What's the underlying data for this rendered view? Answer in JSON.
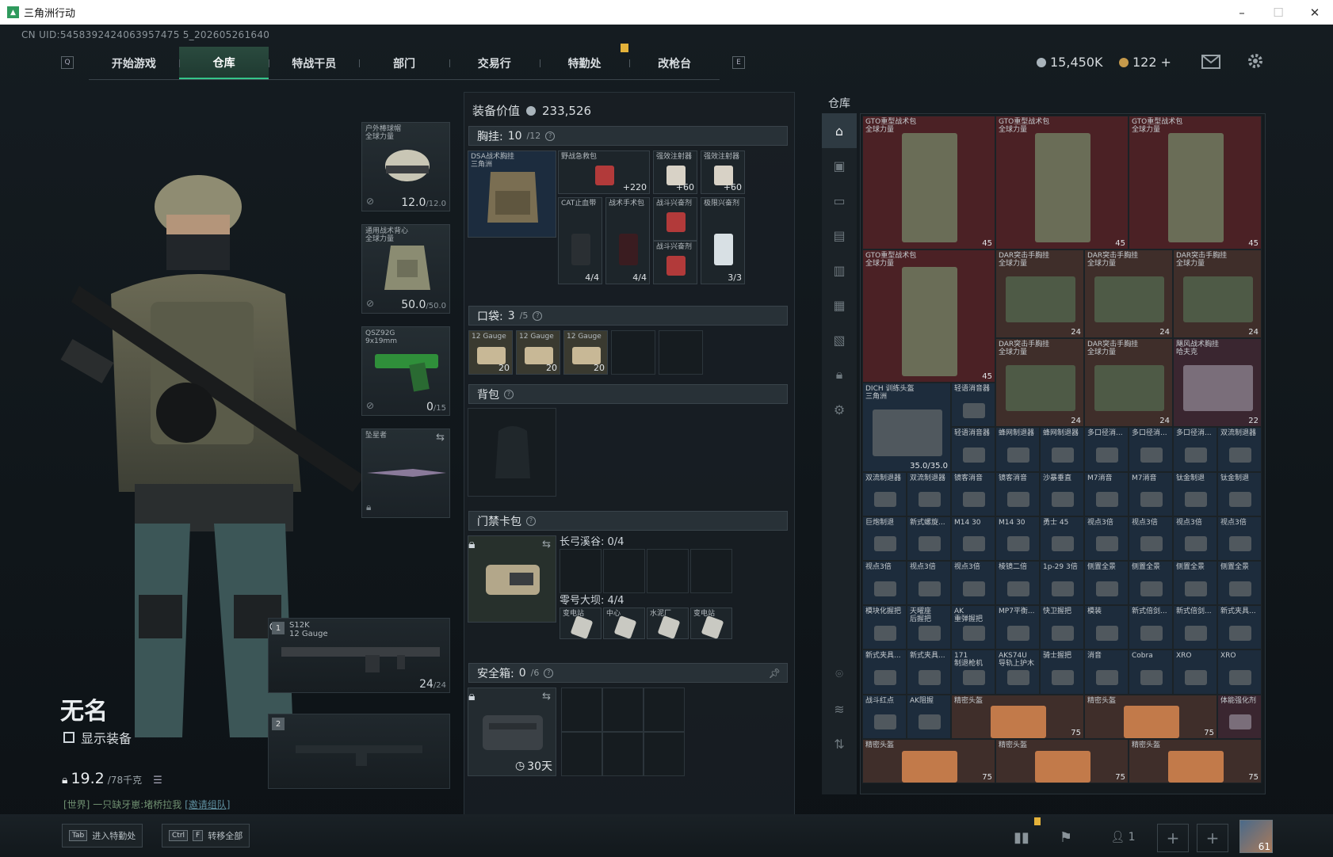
{
  "window": {
    "title": "三角洲行动",
    "min": "–",
    "max": "☐",
    "close": "✕"
  },
  "uid": "CN UID:5458392424063957475 5_202605261640",
  "nav": {
    "left_key": "Q",
    "right_key": "E",
    "tabs": [
      "开始游戏",
      "仓库",
      "特战干员",
      "部门",
      "交易行",
      "特勤处",
      "改枪台"
    ],
    "active": 1
  },
  "currency": {
    "silver": "15,450K",
    "gold": "122",
    "gold_plus": "+"
  },
  "character": {
    "name": "无名",
    "show_equipment": "显示装备",
    "weight": "19.2",
    "weight_max": "/78千克"
  },
  "chat": {
    "channel": "[世界]",
    "text": "一只缺牙崽:堵桥拉我",
    "link": "[邀请组队]"
  },
  "equip_slots": {
    "helmet": {
      "label1": "户外棒球帽",
      "label2": "全球力量",
      "value": "12.0",
      "max": "/12.0"
    },
    "armor": {
      "label1": "通用战术背心",
      "label2": "全球力量",
      "value": "50.0",
      "max": "/50.0"
    },
    "pistol": {
      "label1": "QSZ92G",
      "label2": "9x19mm",
      "value": "0",
      "max": "/15"
    },
    "melee": {
      "label1": "坠星者",
      "label2": ""
    },
    "primary": {
      "num": "1",
      "label1": "S12K",
      "label2": "12 Gauge",
      "value": "24",
      "max": "/24"
    },
    "secondary": {
      "num": "2"
    }
  },
  "loadout": {
    "value_label": "装备价值",
    "value": "233,526",
    "chest": {
      "title": "胸挂:",
      "cap": "10",
      "cap_max": "/12"
    },
    "chest_rig": {
      "label1": "DSA战术胸挂",
      "label2": "三角洲"
    },
    "chest_items": [
      {
        "label": "野战急救包",
        "count": "+220"
      },
      {
        "label": "强效注射器",
        "count": "+60"
      },
      {
        "label": "强效注射器",
        "count": "+60"
      },
      {
        "label": "CAT止血带",
        "count": "4/4"
      },
      {
        "label": "战术手术包",
        "count": "4/4"
      },
      {
        "label": "战斗兴奋剂",
        "count": ""
      },
      {
        "label": "战斗兴奋剂",
        "count": ""
      },
      {
        "label": "极限兴奋剂",
        "count": "3/3"
      }
    ],
    "pocket": {
      "title": "口袋:",
      "cap": "3",
      "cap_max": "/5"
    },
    "pocket_items": [
      {
        "label1": "12 Gauge",
        "count": "20"
      },
      {
        "label1": "12 Gauge",
        "count": "20"
      },
      {
        "label1": "12 Gauge",
        "count": "20"
      }
    ],
    "backpack": {
      "title": "背包"
    },
    "keycard": {
      "title": "门禁卡包"
    },
    "keycard_groups": [
      {
        "title": "长弓溪谷: 0/4",
        "items": [
          "",
          "",
          "",
          ""
        ]
      },
      {
        "title": "零号大坝: 4/4",
        "items": [
          "变电站",
          "中心",
          "水泥厂",
          "变电站"
        ]
      }
    ],
    "safe": {
      "title": "安全箱:",
      "cap": "0",
      "cap_max": "/6",
      "timer": "30天"
    }
  },
  "warehouse": {
    "title": "仓库",
    "items": [
      {
        "r": 0,
        "c": 0,
        "w": 3,
        "h": 3,
        "label1": "GTO重型战术包",
        "label2": "全球力量",
        "count": "45",
        "color": "red"
      },
      {
        "r": 0,
        "c": 3,
        "w": 3,
        "h": 3,
        "label1": "GTO重型战术包",
        "label2": "全球力量",
        "count": "45",
        "color": "red"
      },
      {
        "r": 0,
        "c": 6,
        "w": 3,
        "h": 3,
        "label1": "GTO重型战术包",
        "label2": "全球力量",
        "count": "45",
        "color": "red"
      },
      {
        "r": 3,
        "c": 0,
        "w": 3,
        "h": 3,
        "label1": "GTO重型战术包",
        "label2": "全球力量",
        "count": "45",
        "color": "red"
      },
      {
        "r": 3,
        "c": 3,
        "w": 2,
        "h": 2,
        "label1": "DAR突击手胸挂",
        "label2": "全球力量",
        "count": "24",
        "color": "brown"
      },
      {
        "r": 3,
        "c": 5,
        "w": 2,
        "h": 2,
        "label1": "DAR突击手胸挂",
        "label2": "全球力量",
        "count": "24",
        "color": "brown"
      },
      {
        "r": 3,
        "c": 7,
        "w": 2,
        "h": 2,
        "label1": "DAR突击手胸挂",
        "label2": "全球力量",
        "count": "24",
        "color": "brown"
      },
      {
        "r": 5,
        "c": 3,
        "w": 2,
        "h": 2,
        "label1": "DAR突击手胸挂",
        "label2": "全球力量",
        "count": "24",
        "color": "brown"
      },
      {
        "r": 5,
        "c": 5,
        "w": 2,
        "h": 2,
        "label1": "DAR突击手胸挂",
        "label2": "全球力量",
        "count": "24",
        "color": "brown"
      },
      {
        "r": 5,
        "c": 7,
        "w": 2,
        "h": 2,
        "label1": "飓风战术胸挂",
        "label2": "哈夫克",
        "count": "22",
        "color": "purple"
      },
      {
        "r": 6,
        "c": 0,
        "w": 2,
        "h": 2,
        "label1": "DICH 训练头盔",
        "label2": "三角洲",
        "count": "35.0/35.0",
        "color": "blue"
      },
      {
        "r": 6,
        "c": 2,
        "w": 1,
        "h": 1,
        "label1": "轻语消音器",
        "label2": "",
        "count": "",
        "color": "blue"
      },
      {
        "r": 7,
        "c": 2,
        "w": 1,
        "h": 1,
        "label1": "轻语消音器",
        "label2": "",
        "count": "",
        "color": "blue"
      },
      {
        "r": 7,
        "c": 3,
        "w": 1,
        "h": 1,
        "label1": "蜂网制退器",
        "label2": "",
        "count": "",
        "color": "blue"
      },
      {
        "r": 7,
        "c": 4,
        "w": 1,
        "h": 1,
        "label1": "蜂网制退器",
        "label2": "",
        "count": "",
        "color": "blue"
      },
      {
        "r": 7,
        "c": 5,
        "w": 1,
        "h": 1,
        "label1": "多口径消...",
        "label2": "",
        "count": "",
        "color": "blue"
      },
      {
        "r": 7,
        "c": 6,
        "w": 1,
        "h": 1,
        "label1": "多口径消...",
        "label2": "",
        "count": "",
        "color": "blue"
      },
      {
        "r": 7,
        "c": 7,
        "w": 1,
        "h": 1,
        "label1": "多口径消...",
        "label2": "",
        "count": "",
        "color": "blue"
      },
      {
        "r": 7,
        "c": 8,
        "w": 1,
        "h": 1,
        "label1": "双流制退器",
        "label2": "",
        "count": "",
        "color": "blue"
      },
      {
        "r": 8,
        "c": 0,
        "w": 1,
        "h": 1,
        "label1": "双流制退器",
        "label2": "",
        "count": "",
        "color": "blue"
      },
      {
        "r": 8,
        "c": 1,
        "w": 1,
        "h": 1,
        "label1": "双流制退器",
        "label2": "",
        "count": "",
        "color": "blue"
      },
      {
        "r": 8,
        "c": 2,
        "w": 1,
        "h": 1,
        "label1": "镜客消音",
        "label2": "",
        "count": "",
        "color": "blue"
      },
      {
        "r": 8,
        "c": 3,
        "w": 1,
        "h": 1,
        "label1": "镜客消音",
        "label2": "",
        "count": "",
        "color": "blue"
      },
      {
        "r": 8,
        "c": 4,
        "w": 1,
        "h": 1,
        "label1": "沙暴垂直",
        "label2": "",
        "count": "",
        "color": "blue"
      },
      {
        "r": 8,
        "c": 5,
        "w": 1,
        "h": 1,
        "label1": "M7消音",
        "label2": "",
        "count": "",
        "color": "blue"
      },
      {
        "r": 8,
        "c": 6,
        "w": 1,
        "h": 1,
        "label1": "M7消音",
        "label2": "",
        "count": "",
        "color": "blue"
      },
      {
        "r": 8,
        "c": 7,
        "w": 1,
        "h": 1,
        "label1": "钛金制退",
        "label2": "",
        "count": "",
        "color": "blue"
      },
      {
        "r": 8,
        "c": 8,
        "w": 1,
        "h": 1,
        "label1": "钛金制退",
        "label2": "",
        "count": "",
        "color": "blue"
      },
      {
        "r": 9,
        "c": 0,
        "w": 1,
        "h": 1,
        "label1": "巨炮制退",
        "label2": "",
        "count": "",
        "color": "blue"
      },
      {
        "r": 9,
        "c": 1,
        "w": 1,
        "h": 1,
        "label1": "新式螺旋...",
        "label2": "",
        "count": "",
        "color": "blue"
      },
      {
        "r": 9,
        "c": 2,
        "w": 1,
        "h": 1,
        "label1": "M14 30",
        "label2": "",
        "count": "",
        "color": "blue"
      },
      {
        "r": 9,
        "c": 3,
        "w": 1,
        "h": 1,
        "label1": "M14 30",
        "label2": "",
        "count": "",
        "color": "blue"
      },
      {
        "r": 9,
        "c": 4,
        "w": 1,
        "h": 1,
        "label1": "勇士 45",
        "label2": "",
        "count": "",
        "color": "blue"
      },
      {
        "r": 9,
        "c": 5,
        "w": 1,
        "h": 1,
        "label1": "视点3倍",
        "label2": "",
        "count": "",
        "color": "blue"
      },
      {
        "r": 9,
        "c": 6,
        "w": 1,
        "h": 1,
        "label1": "视点3倍",
        "label2": "",
        "count": "",
        "color": "blue"
      },
      {
        "r": 9,
        "c": 7,
        "w": 1,
        "h": 1,
        "label1": "视点3倍",
        "label2": "",
        "count": "",
        "color": "blue"
      },
      {
        "r": 9,
        "c": 8,
        "w": 1,
        "h": 1,
        "label1": "视点3倍",
        "label2": "",
        "count": "",
        "color": "blue"
      },
      {
        "r": 10,
        "c": 0,
        "w": 1,
        "h": 1,
        "label1": "视点3倍",
        "label2": "",
        "count": "",
        "color": "blue"
      },
      {
        "r": 10,
        "c": 1,
        "w": 1,
        "h": 1,
        "label1": "视点3倍",
        "label2": "",
        "count": "",
        "color": "blue"
      },
      {
        "r": 10,
        "c": 2,
        "w": 1,
        "h": 1,
        "label1": "视点3倍",
        "label2": "",
        "count": "",
        "color": "blue"
      },
      {
        "r": 10,
        "c": 3,
        "w": 1,
        "h": 1,
        "label1": "棱镜二倍",
        "label2": "",
        "count": "",
        "color": "blue"
      },
      {
        "r": 10,
        "c": 4,
        "w": 1,
        "h": 1,
        "label1": "1p-29 3倍",
        "label2": "",
        "count": "",
        "color": "blue"
      },
      {
        "r": 10,
        "c": 5,
        "w": 1,
        "h": 1,
        "label1": "侧置全景",
        "label2": "",
        "count": "",
        "color": "blue"
      },
      {
        "r": 10,
        "c": 6,
        "w": 1,
        "h": 1,
        "label1": "侧置全景",
        "label2": "",
        "count": "",
        "color": "blue"
      },
      {
        "r": 10,
        "c": 7,
        "w": 1,
        "h": 1,
        "label1": "侧置全景",
        "label2": "",
        "count": "",
        "color": "blue"
      },
      {
        "r": 10,
        "c": 8,
        "w": 1,
        "h": 1,
        "label1": "侧置全景",
        "label2": "",
        "count": "",
        "color": "blue"
      },
      {
        "r": 11,
        "c": 0,
        "w": 1,
        "h": 1,
        "label1": "模块化握把",
        "label2": "",
        "count": "",
        "color": "blue"
      },
      {
        "r": 11,
        "c": 1,
        "w": 1,
        "h": 1,
        "label1": "天曜座",
        "label2": "后握把",
        "count": "",
        "color": "blue"
      },
      {
        "r": 11,
        "c": 2,
        "w": 1,
        "h": 1,
        "label1": "AK",
        "label2": "重弹握把",
        "count": "",
        "color": "blue"
      },
      {
        "r": 11,
        "c": 3,
        "w": 1,
        "h": 1,
        "label1": "MP7平衡...",
        "label2": "",
        "count": "",
        "color": "blue"
      },
      {
        "r": 11,
        "c": 4,
        "w": 1,
        "h": 1,
        "label1": "快卫握把",
        "label2": "",
        "count": "",
        "color": "blue"
      },
      {
        "r": 11,
        "c": 5,
        "w": 1,
        "h": 1,
        "label1": "模装",
        "label2": "",
        "count": "",
        "color": "blue"
      },
      {
        "r": 11,
        "c": 6,
        "w": 1,
        "h": 1,
        "label1": "新式倍剑...",
        "label2": "",
        "count": "",
        "color": "blue"
      },
      {
        "r": 11,
        "c": 7,
        "w": 1,
        "h": 1,
        "label1": "新式倍剑...",
        "label2": "",
        "count": "",
        "color": "blue"
      },
      {
        "r": 11,
        "c": 8,
        "w": 1,
        "h": 1,
        "label1": "新式夹具...",
        "label2": "",
        "count": "",
        "color": "blue"
      },
      {
        "r": 12,
        "c": 0,
        "w": 1,
        "h": 1,
        "label1": "新式夹具...",
        "label2": "",
        "count": "",
        "color": "blue"
      },
      {
        "r": 12,
        "c": 1,
        "w": 1,
        "h": 1,
        "label1": "新式夹具...",
        "label2": "",
        "count": "",
        "color": "blue"
      },
      {
        "r": 12,
        "c": 2,
        "w": 1,
        "h": 1,
        "label1": "171",
        "label2": "制退枪机",
        "count": "",
        "color": "blue"
      },
      {
        "r": 12,
        "c": 3,
        "w": 1,
        "h": 1,
        "label1": "AKS74U",
        "label2": "导轨上护木",
        "count": "",
        "color": "blue"
      },
      {
        "r": 12,
        "c": 4,
        "w": 1,
        "h": 1,
        "label1": "骑士握把",
        "label2": "",
        "count": "",
        "color": "blue"
      },
      {
        "r": 12,
        "c": 5,
        "w": 1,
        "h": 1,
        "label1": "消音",
        "label2": "",
        "count": "",
        "color": "blue"
      },
      {
        "r": 12,
        "c": 6,
        "w": 1,
        "h": 1,
        "label1": "Cobra",
        "label2": "",
        "count": "",
        "color": "blue"
      },
      {
        "r": 12,
        "c": 7,
        "w": 1,
        "h": 1,
        "label1": "XRO",
        "label2": "",
        "count": "",
        "color": "blue"
      },
      {
        "r": 12,
        "c": 8,
        "w": 1,
        "h": 1,
        "label1": "XRO",
        "label2": "",
        "count": "",
        "color": "blue"
      },
      {
        "r": 13,
        "c": 0,
        "w": 1,
        "h": 1,
        "label1": "战斗红点",
        "label2": "",
        "count": "",
        "color": "blue"
      },
      {
        "r": 13,
        "c": 1,
        "w": 1,
        "h": 1,
        "label1": "AK阻握",
        "label2": "",
        "count": "",
        "color": "blue"
      },
      {
        "r": 13,
        "c": 2,
        "w": 3,
        "h": 1,
        "label1": "精密头盔",
        "label2": "",
        "count": "75",
        "color": "brown"
      },
      {
        "r": 13,
        "c": 5,
        "w": 3,
        "h": 1,
        "label1": "精密头盔",
        "label2": "",
        "count": "75",
        "color": "brown"
      },
      {
        "r": 13,
        "c": 8,
        "w": 1,
        "h": 1,
        "label1": "体能强化剂",
        "label2": "",
        "count": "",
        "color": "purple"
      },
      {
        "r": 14,
        "c": 0,
        "w": 3,
        "h": 1,
        "label1": "精密头盔",
        "label2": "",
        "count": "75",
        "color": "brown"
      },
      {
        "r": 14,
        "c": 3,
        "w": 3,
        "h": 1,
        "label1": "精密头盔",
        "label2": "",
        "count": "75",
        "color": "brown"
      },
      {
        "r": 14,
        "c": 6,
        "w": 3,
        "h": 1,
        "label1": "精密头盔",
        "label2": "",
        "count": "75",
        "color": "brown"
      }
    ]
  },
  "bottom": {
    "hint1_key": "Tab",
    "hint1_label": "进入特勤处",
    "hint2_key1": "Ctrl",
    "hint2_key2": "F",
    "hint2_label": "转移全部",
    "party_count": "1",
    "level": "61"
  },
  "colors": {
    "accent": "#35c58a",
    "red": "#4b2125",
    "brown": "#3f2e2a",
    "blue": "#1d2c3c",
    "purple": "#3a2630"
  }
}
